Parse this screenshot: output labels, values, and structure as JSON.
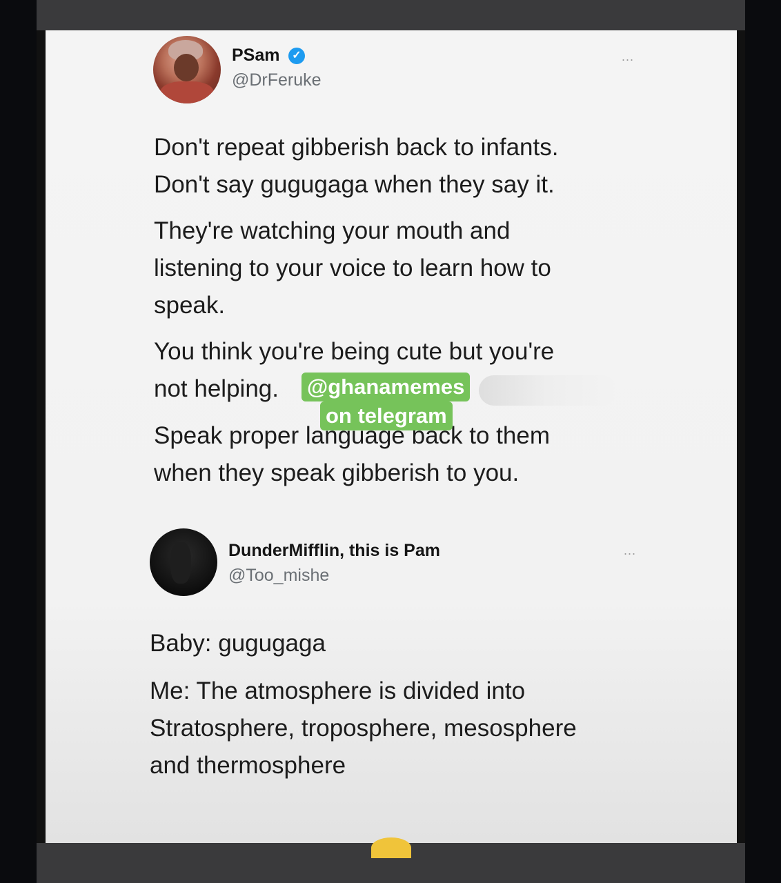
{
  "tweet1": {
    "name": "PSam",
    "handle": "@DrFeruke",
    "verified_icon": "verified-badge-icon",
    "more": "...",
    "lines": [
      "Don't repeat gibberish back to infants.",
      "Don't say gugugaga when they say it.",
      "They're watching your mouth and",
      "listening to your voice to learn how to",
      "speak.",
      "You think you're being cute but you're",
      "not helping.",
      "Speak proper language back to them",
      "when they speak gibberish to you."
    ]
  },
  "watermark": {
    "line1": "@ghanamemes",
    "line2": "on telegram"
  },
  "tweet2": {
    "name": "DunderMifflin, this is Pam",
    "handle": "@Too_mishe",
    "more": "...",
    "lines": [
      "Baby: gugugaga",
      "Me: The atmosphere is divided into",
      "Stratosphere, troposphere, mesosphere",
      "and thermosphere"
    ]
  },
  "colors": {
    "card_bg": "#f4f4f4",
    "verified_blue": "#1d9bf0",
    "watermark_green": "#76c35a",
    "frame_gray": "#3a3a3c"
  }
}
